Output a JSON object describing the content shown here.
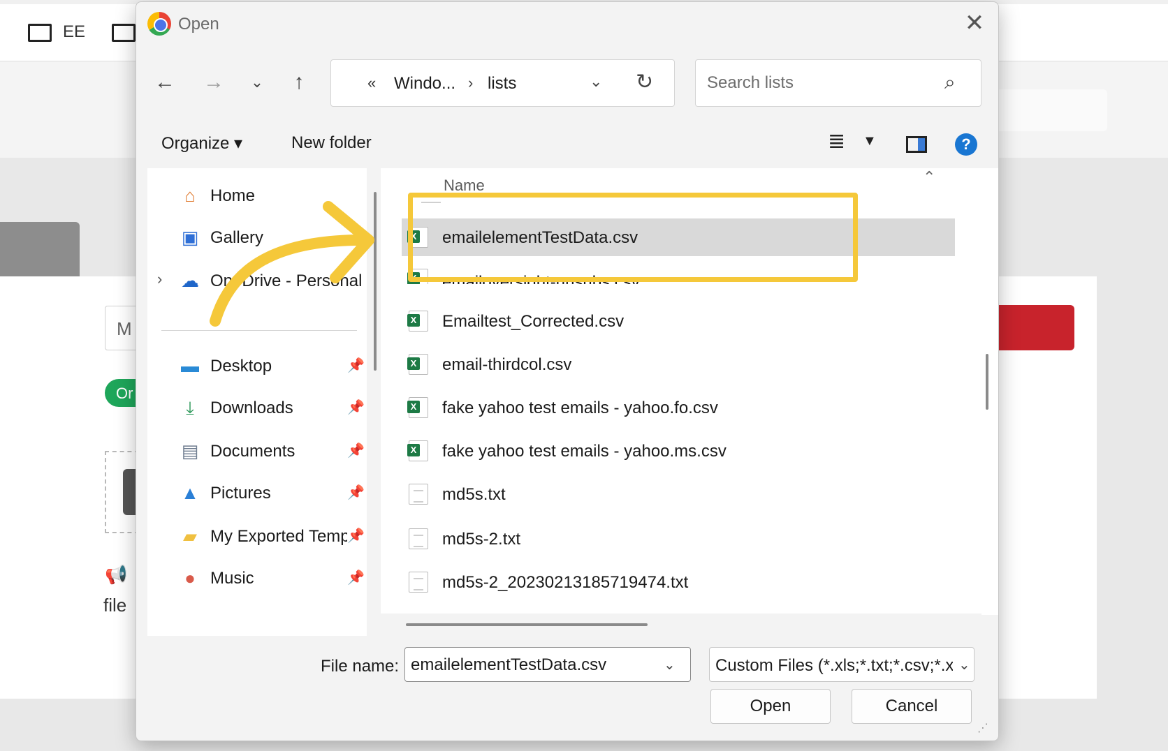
{
  "background": {
    "topbar_label": "EE",
    "input_text": "M",
    "pill_text": "Or",
    "file_text": "file"
  },
  "dialog": {
    "title": "Open",
    "address": {
      "prefix": "«",
      "segments": [
        "Windo...",
        "lists"
      ],
      "separator": "›"
    },
    "search": {
      "placeholder": "Search lists"
    },
    "toolbar": {
      "organize": "Organize ▾",
      "new_folder": "New folder"
    },
    "nav": {
      "items": [
        {
          "label": "Home",
          "icon": "home-icon"
        },
        {
          "label": "Gallery",
          "icon": "gallery-icon"
        },
        {
          "label": "OneDrive - Personal",
          "icon": "onedrive-icon"
        },
        {
          "label": "Desktop",
          "icon": "desktop-icon",
          "pinned": true
        },
        {
          "label": "Downloads",
          "icon": "downloads-icon",
          "pinned": true
        },
        {
          "label": "Documents",
          "icon": "documents-icon",
          "pinned": true
        },
        {
          "label": "Pictures",
          "icon": "pictures-icon",
          "pinned": true
        },
        {
          "label": "My Exported Temp",
          "icon": "folder-icon",
          "pinned": true
        },
        {
          "label": "Music",
          "icon": "music-icon",
          "pinned": true
        }
      ]
    },
    "files": {
      "column_name": "Name",
      "items": [
        {
          "name": "emailelementTestData.csv",
          "type": "csv",
          "selected": true
        },
        {
          "name": "emailoversight-unsubs.csv",
          "type": "csv"
        },
        {
          "name": "Emailtest_Corrected.csv",
          "type": "csv"
        },
        {
          "name": "email-thirdcol.csv",
          "type": "csv"
        },
        {
          "name": "fake yahoo test emails - yahoo.fo.csv",
          "type": "csv"
        },
        {
          "name": "fake yahoo test emails - yahoo.ms.csv",
          "type": "csv"
        },
        {
          "name": "md5s.txt",
          "type": "txt"
        },
        {
          "name": "md5s-2.txt",
          "type": "txt"
        },
        {
          "name": "md5s-2_20230213185719474.txt",
          "type": "txt"
        }
      ]
    },
    "bottom": {
      "file_name_label": "File name:",
      "file_name_value": "emailelementTestData.csv",
      "file_type": "Custom Files (*.xls;*.txt;*.csv;*.x",
      "open_label": "Open",
      "cancel_label": "Cancel"
    }
  },
  "colors": {
    "highlight": "#f5c83a",
    "selected_row": "#d9d9d9",
    "help": "#1976d2",
    "excel": "#1d7a45"
  }
}
